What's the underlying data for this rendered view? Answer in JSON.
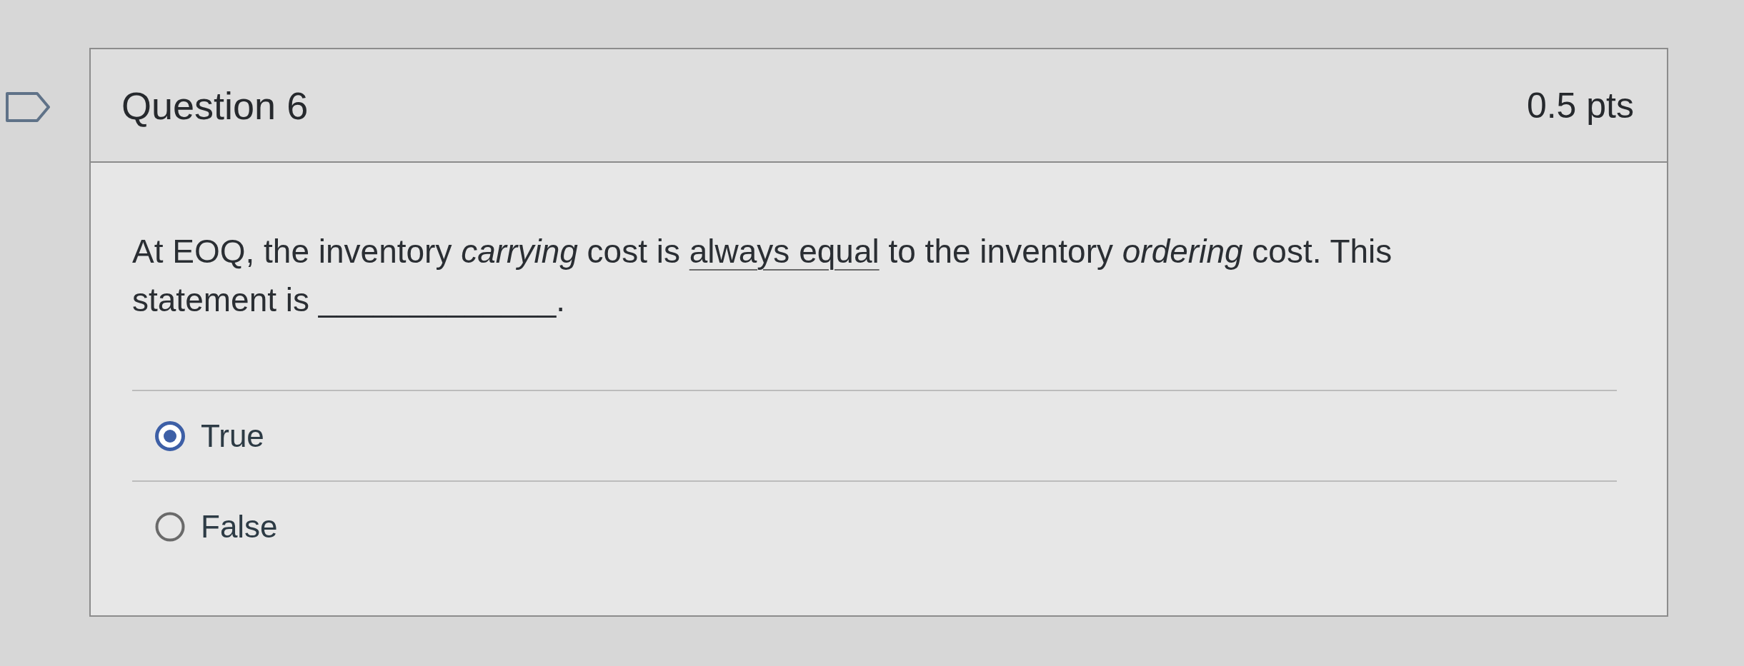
{
  "flag": {
    "flagged": false
  },
  "question": {
    "title": "Question 6",
    "points": "0.5 pts",
    "text": [
      {
        "kind": "plain",
        "text": "At EOQ, the inventory "
      },
      {
        "kind": "italic",
        "text": "carrying"
      },
      {
        "kind": "plain",
        "text": " cost is "
      },
      {
        "kind": "underline",
        "text": "always equal"
      },
      {
        "kind": "plain",
        "text": " to the inventory "
      },
      {
        "kind": "italic",
        "text": "ordering"
      },
      {
        "kind": "plain",
        "text": " cost. This statement is _____________."
      }
    ],
    "answers": [
      {
        "label": "True",
        "selected": true
      },
      {
        "label": "False",
        "selected": false
      }
    ]
  }
}
